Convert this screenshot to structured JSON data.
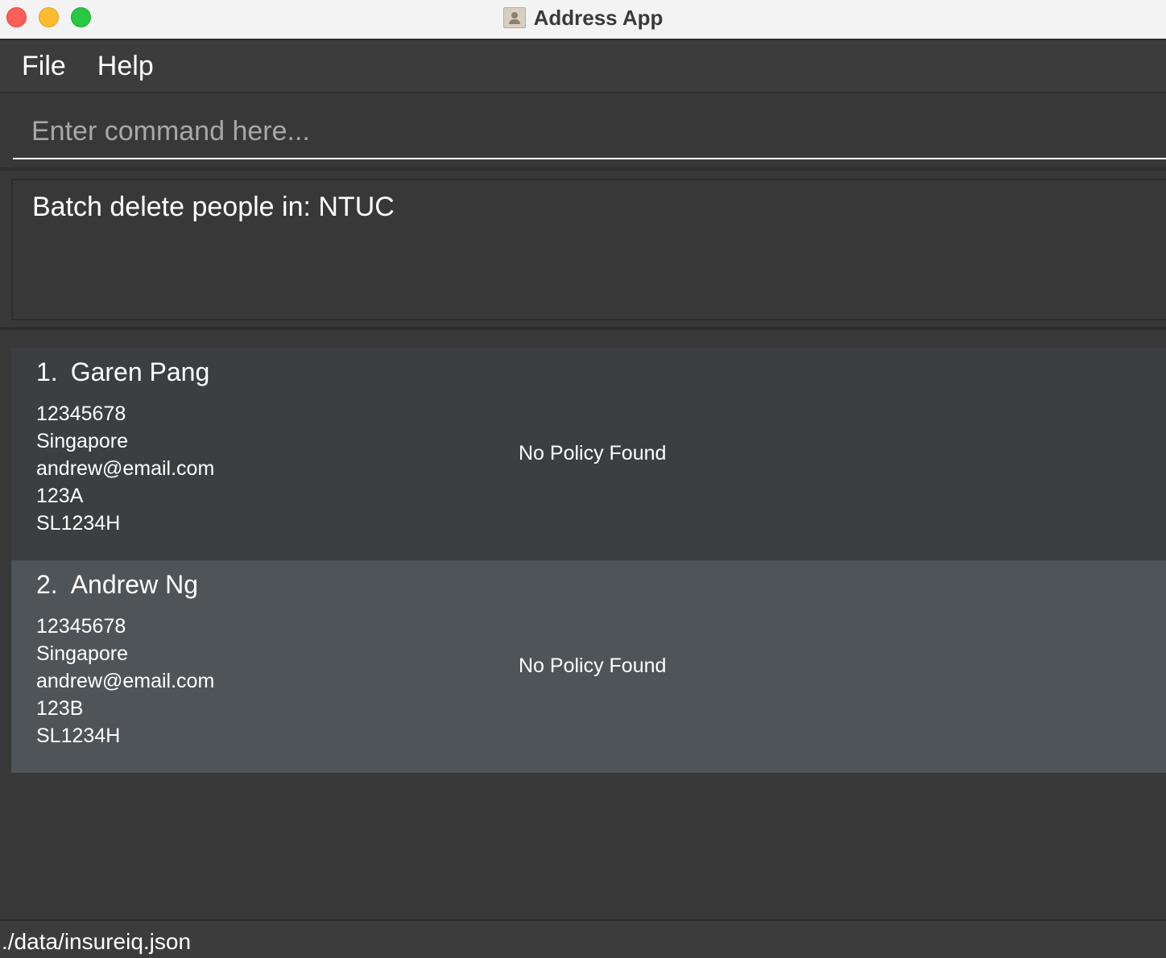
{
  "window": {
    "title": "Address App",
    "icon": "address-book-icon"
  },
  "menu": {
    "items": [
      {
        "label": "File"
      },
      {
        "label": "Help"
      }
    ]
  },
  "command": {
    "placeholder": "Enter command here...",
    "value": ""
  },
  "result": {
    "message": "Batch delete people in: NTUC"
  },
  "persons": [
    {
      "index": "1.",
      "name": "Garen Pang",
      "phone": "12345678",
      "address": "Singapore",
      "email": "andrew@email.com",
      "unit": "123A",
      "nric": "SL1234H",
      "policy": "No Policy Found"
    },
    {
      "index": "2.",
      "name": "Andrew Ng",
      "phone": "12345678",
      "address": "Singapore",
      "email": "andrew@email.com",
      "unit": "123B",
      "nric": "SL1234H",
      "policy": "No Policy Found"
    }
  ],
  "status": {
    "file_path": "./data/insureiq.json"
  },
  "colors": {
    "background": "#383838",
    "card_odd": "#3c3e41",
    "card_selected": "#4f5458",
    "text": "#ffffff",
    "placeholder": "#a8a8a8"
  }
}
